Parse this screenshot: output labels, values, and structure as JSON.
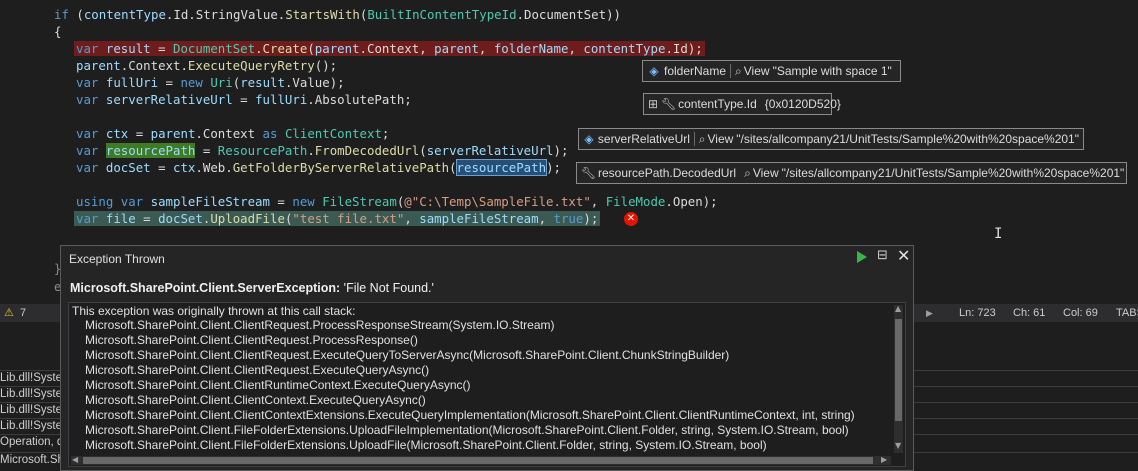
{
  "editor": {
    "lines": [
      "if (contentType.Id.StringValue.StartsWith(BuiltInContentTypeId.DocumentSet))",
      "{",
      "var result = DocumentSet.Create(parent.Context, parent, folderName, contentType.Id);",
      "parent.Context.ExecuteQueryRetry();",
      "var fullUri = new Uri(result.Value);",
      "var serverRelativeUrl = fullUri.AbsolutePath;",
      "",
      "var ctx = parent.Context as ClientContext;",
      "var resourcePath = ResourcePath.FromDecodedUrl(serverRelativeUrl);",
      "var docSet = ctx.Web.GetFolderByServerRelativePath(resourcePath);",
      "",
      "using var sampleFileStream = new FileStream(@\"C:\\Temp\\SampleFile.txt\", FileMode.Open);",
      "var file = docSet.UploadFile(\"test file.txt\", sampleFileStream, true);"
    ]
  },
  "datatips": [
    {
      "name": "folderName",
      "view": "View",
      "value": "\"Sample with space 1\""
    },
    {
      "name": "contentType.Id",
      "value": "{0x0120D520}"
    },
    {
      "name": "serverRelativeUrl",
      "view": "View",
      "value": "\"/sites/allcompany21/UnitTests/Sample%20with%20space%201\""
    },
    {
      "name": "resourcePath.DecodedUrl",
      "view": "View",
      "value": "\"/sites/allcompany21/UnitTests/Sample%20with%20space%201\""
    }
  ],
  "status": {
    "warnings": "7",
    "ln": "Ln: 723",
    "ch": "Ch: 61",
    "col": "Col: 69",
    "tabs": "TABS"
  },
  "exception": {
    "title": "Exception Thrown",
    "type": "Microsoft.SharePoint.Client.ServerException:",
    "message": " 'File Not Found.'",
    "stack_header": "This exception was originally thrown at this call stack:",
    "frames": [
      "Microsoft.SharePoint.Client.ClientRequest.ProcessResponseStream(System.IO.Stream)",
      "Microsoft.SharePoint.Client.ClientRequest.ProcessResponse()",
      "Microsoft.SharePoint.Client.ClientRequest.ExecuteQueryToServerAsync(Microsoft.SharePoint.Client.ChunkStringBuilder)",
      "Microsoft.SharePoint.Client.ClientRequest.ExecuteQueryAsync()",
      "Microsoft.SharePoint.Client.ClientRuntimeContext.ExecuteQueryAsync()",
      "Microsoft.SharePoint.Client.ClientContext.ExecuteQueryAsync()",
      "Microsoft.SharePoint.Client.ClientContextExtensions.ExecuteQueryImplementation(Microsoft.SharePoint.Client.ClientRuntimeContext, int, string)",
      "Microsoft.SharePoint.Client.FileFolderExtensions.UploadFileImplementation(Microsoft.SharePoint.Client.Folder, string, System.IO.Stream, bool)",
      "Microsoft.SharePoint.Client.FileFolderExtensions.UploadFile(Microsoft.SharePoint.Client.Folder, string, System.IO.Stream, bool)"
    ]
  },
  "panel": {
    "rows": [
      "Lib.dll!Syste",
      "Lib.dll!Syste",
      "Lib.dll!Syste",
      "Lib.dll!Syste",
      "Operation, d",
      "Microsoft.Sh"
    ]
  },
  "colors": {
    "error": "#e51400",
    "play": "#3bb54a",
    "keyword": "#569cd6",
    "type": "#4ec9b0"
  },
  "icons": {
    "warning": "warning-icon",
    "error": "error-icon",
    "continue": "play-icon",
    "close": "close-icon"
  }
}
